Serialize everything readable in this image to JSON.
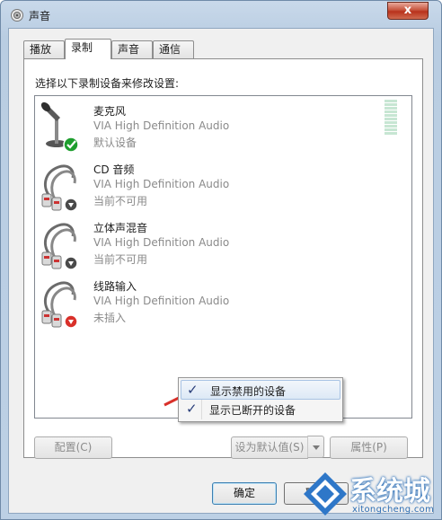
{
  "window": {
    "title": "声音",
    "close_label": "x"
  },
  "tabs": [
    {
      "label": "播放",
      "active": false
    },
    {
      "label": "录制",
      "active": true
    },
    {
      "label": "声音",
      "active": false
    },
    {
      "label": "通信",
      "active": false
    }
  ],
  "prompt": "选择以下录制设备来修改设置:",
  "devices": [
    {
      "name": "麦克风",
      "driver": "VIA High Definition Audio",
      "state": "默认设备",
      "icon": "microphone-icon",
      "badge": "green-check-badge"
    },
    {
      "name": "CD 音频",
      "driver": "VIA High Definition Audio",
      "state": "当前不可用",
      "icon": "rca-cable-icon",
      "badge": "gray-down-arrow-badge"
    },
    {
      "name": "立体声混音",
      "driver": "VIA High Definition Audio",
      "state": "当前不可用",
      "icon": "rca-cable-icon",
      "badge": "gray-down-arrow-badge"
    },
    {
      "name": "线路输入",
      "driver": "VIA High Definition Audio",
      "state": "未插入",
      "icon": "rca-cable-icon",
      "badge": "red-down-arrow-badge"
    }
  ],
  "context_menu": {
    "items": [
      {
        "label": "显示禁用的设备",
        "checked": true
      },
      {
        "label": "显示已断开的设备",
        "checked": true
      }
    ]
  },
  "buttons": {
    "configure": "配置(C)",
    "set_default": "设为默认值(S)",
    "properties": "属性(P)",
    "ok": "确定",
    "cancel": "取消"
  },
  "watermark": {
    "brand": "系统城",
    "url": "xitongcheng.com"
  },
  "colors": {
    "accent_blue": "#3c7fb1",
    "arrow_red": "#d9302a",
    "check_green": "#1e9e2e"
  }
}
